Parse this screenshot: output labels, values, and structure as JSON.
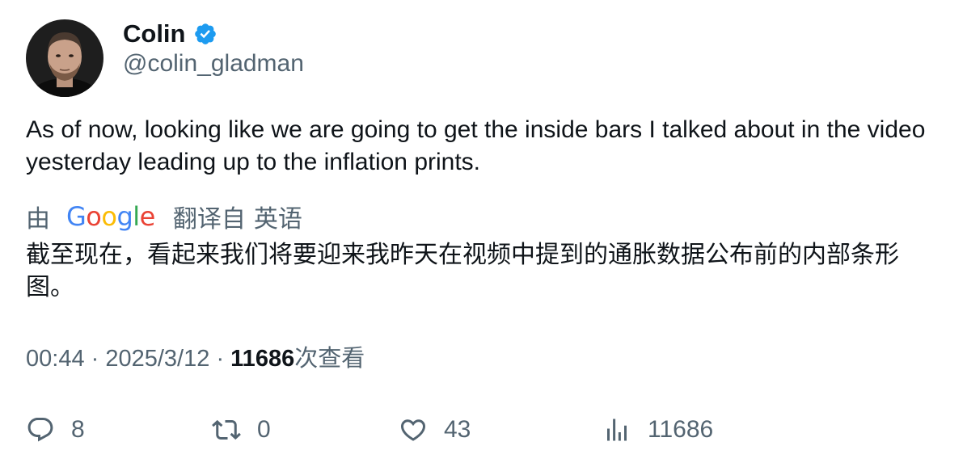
{
  "author": {
    "display_name": "Colin",
    "handle": "@colin_gladman",
    "verified_icon": "verified-badge-icon",
    "badge_color": "#1d9bf0"
  },
  "tweet": {
    "text": "As of now, looking like we are going to get the inside bars I talked about in the video yesterday leading up to the inflation prints."
  },
  "translation": {
    "prefix": "由",
    "provider": "Google",
    "suffix": "翻译自",
    "language": "英语",
    "text": "截至现在，看起来我们将要迎来我昨天在视频中提到的通胀数据公布前的内部条形图。"
  },
  "meta": {
    "time": "00:44",
    "separator": "·",
    "date": "2025/3/12",
    "views_count": "11686",
    "views_label": "次查看"
  },
  "actions": {
    "reply": {
      "icon": "reply-icon",
      "count": "8"
    },
    "retweet": {
      "icon": "retweet-icon",
      "count": "0"
    },
    "like": {
      "icon": "heart-icon",
      "count": "43"
    },
    "views": {
      "icon": "views-chart-icon",
      "count": "11686"
    }
  },
  "colors": {
    "text_primary": "#0f1419",
    "text_secondary": "#536471",
    "google_blue": "#4285F4",
    "google_red": "#EA4335",
    "google_yellow": "#FBBC05",
    "google_green": "#34A853"
  }
}
